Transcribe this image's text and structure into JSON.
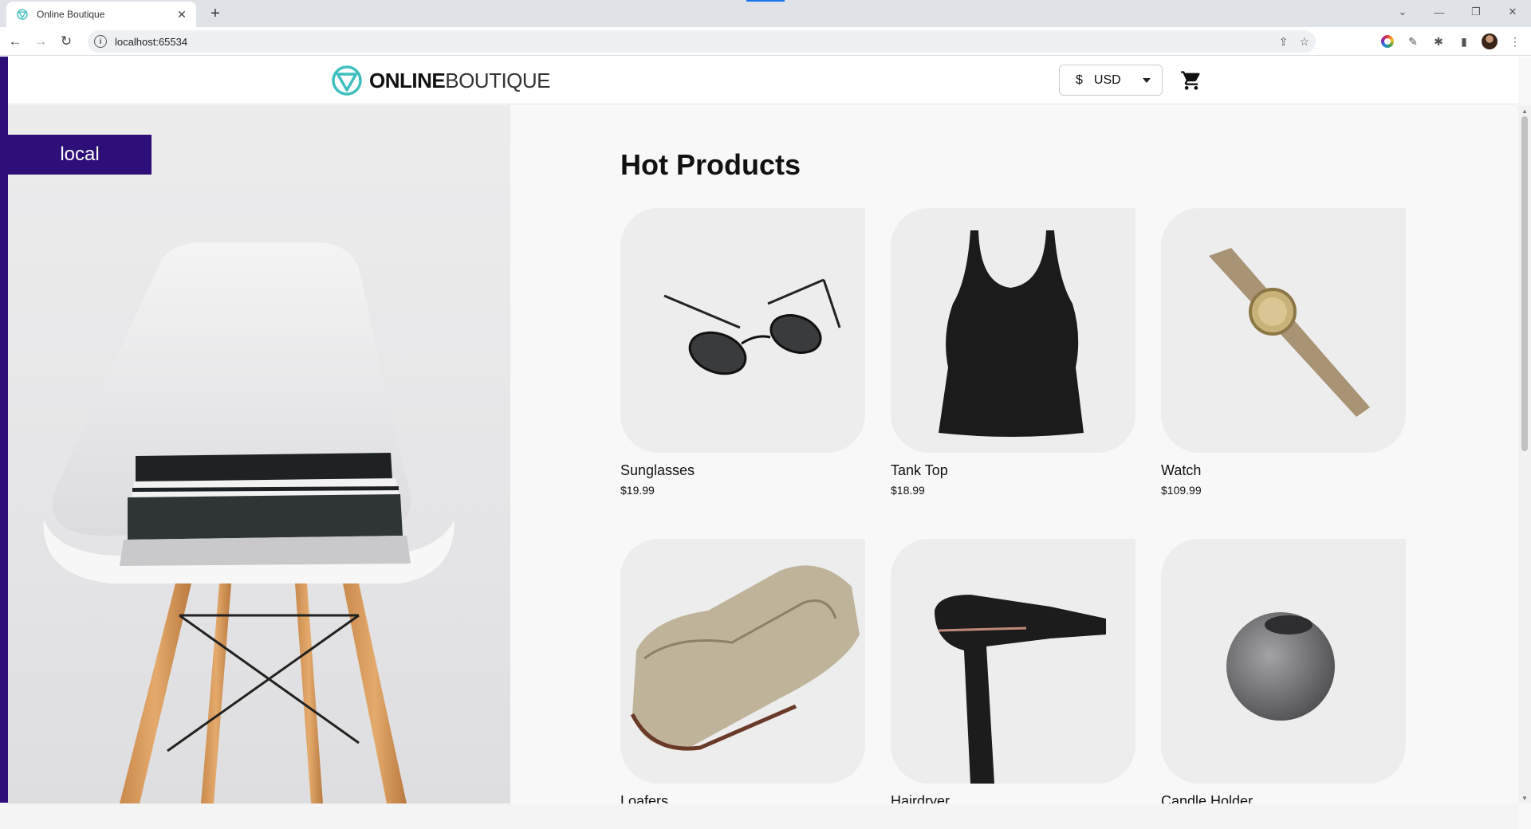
{
  "browser": {
    "tab_title": "Online Boutique",
    "new_tab_symbol": "+",
    "url": "localhost:65534",
    "window_controls": [
      "chevron-down-icon",
      "minimize-icon",
      "restore-icon",
      "close-icon"
    ]
  },
  "header": {
    "logo_bold": "ONLINE",
    "logo_thin": "BOUTIQUE",
    "currency_symbol": "$",
    "currency_code": "USD"
  },
  "hero": {
    "env_label": "local"
  },
  "main": {
    "section_title": "Hot Products",
    "products": [
      {
        "name": "Sunglasses",
        "price": "$19.99",
        "icon": "sunglasses-image"
      },
      {
        "name": "Tank Top",
        "price": "$18.99",
        "icon": "tank-top-image"
      },
      {
        "name": "Watch",
        "price": "$109.99",
        "icon": "watch-image"
      },
      {
        "name": "Loafers",
        "price": "",
        "icon": "loafers-image"
      },
      {
        "name": "Hairdryer",
        "price": "",
        "icon": "hairdryer-image"
      },
      {
        "name": "Candle Holder",
        "price": "",
        "icon": "candle-holder-image"
      }
    ]
  },
  "colors": {
    "brand_teal": "#3fbfbf",
    "env_purple": "#2e0f7a",
    "page_bg": "#f8f8f8"
  }
}
